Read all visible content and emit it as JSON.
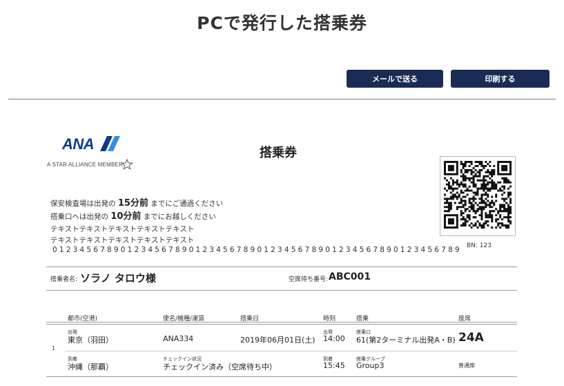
{
  "page": {
    "title": "PCで発行した搭乗券"
  },
  "toolbar": {
    "mail_label": "メールで送る",
    "print_label": "印刷する"
  },
  "logo": {
    "brand": "ANA",
    "tagline": "A STAR ALLIANCE MEMBER",
    "icon": "star-alliance-icon",
    "brand_color": "#0d3a8c"
  },
  "ticket": {
    "title": "搭乗券",
    "notice1": {
      "pre": "保安検査場は出発の",
      "em": "15分前",
      "post": "までにご通過ください"
    },
    "notice2": {
      "pre": "搭乗口へは出発の",
      "em": "10分前",
      "post": "までにお越しください"
    },
    "text_line1": "テキストテキストテキストテキストテキスト",
    "text_line2": "テキストテキストテキストテキストテキスト",
    "digits": "012345678901234567890123456789012345678901234567890123456789",
    "bn": "BN: 123",
    "passenger_label": "搭乗者名:",
    "passenger_name": "ソラノ タロウ様",
    "standby_label": "空席待ち番号:",
    "standby_number": "ABC001"
  },
  "table": {
    "headers": {
      "city": "都市(空港)",
      "flight": "便名/機種/運賃",
      "date": "搭乗日",
      "time": "時刻",
      "boarding": "搭乗",
      "seat": "座席"
    },
    "row": {
      "num": "1",
      "dep_label": "出発",
      "dep_city": "東京（羽田）",
      "flight_no": "ANA334",
      "date": "2019年06月01日(土)",
      "dep_time_label": "出発",
      "dep_time": "14:00",
      "gate_label": "搭乗口",
      "gate": "61(第2ターミナル出発A・B)",
      "seat": "24A",
      "arr_label": "到着",
      "arr_city": "沖縄（那覇）",
      "checkin_label": "チェックイン状況",
      "checkin_status": "チェックイン済み（空席待ち中）",
      "arr_time_label": "到着",
      "arr_time": "15:45",
      "group_label": "搭乗グループ",
      "group": "Group3",
      "seat_class": "普通席"
    }
  },
  "colors": {
    "button_bg": "#1a2b55",
    "brand": "#0d3a8c"
  }
}
